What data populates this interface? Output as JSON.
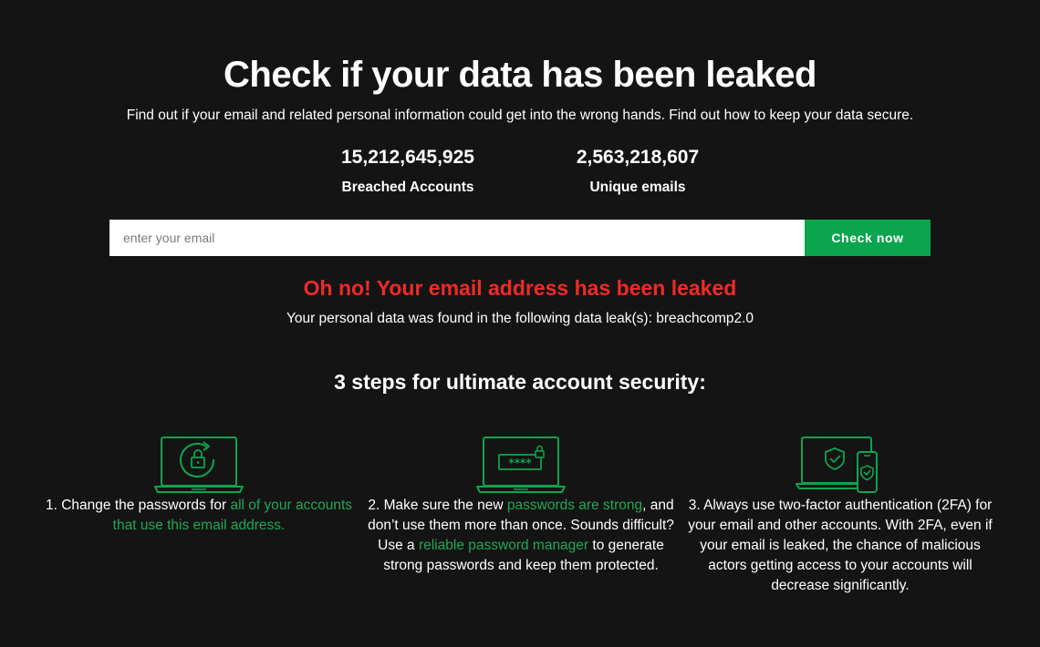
{
  "header": {
    "title": "Check if your data has been leaked",
    "subtitle": "Find out if your email and related personal information could get into the wrong hands. Find out how to keep your data secure."
  },
  "stats": [
    {
      "value": "15,212,645,925",
      "label": "Breached Accounts"
    },
    {
      "value": "2,563,218,607",
      "label": "Unique emails"
    }
  ],
  "search": {
    "placeholder": "enter your email",
    "value": "",
    "button_label": "Check now"
  },
  "result": {
    "alert": "Oh no! Your email address has been leaked",
    "details": "Your personal data was found in the following data leak(s): breachcomp2.0"
  },
  "steps_section": {
    "title": "3 steps for ultimate account security:",
    "steps": [
      {
        "icon": "laptop-refresh-lock-icon",
        "before": "1. Change the passwords for ",
        "link": "all of your accounts that use this email address.",
        "after": ""
      },
      {
        "icon": "laptop-password-icon",
        "before": "2. Make sure the new ",
        "link": "passwords are strong",
        "middle": ", and don’t use them more than once. Sounds difficult? Use a ",
        "link2": "reliable password manager",
        "after": " to generate strong passwords and keep them protected."
      },
      {
        "icon": "laptop-phone-shield-icon",
        "text": "3. Always use two-factor authentication (2FA) for your email and other accounts. With 2FA, even if your email is leaked, the chance of malicious actors getting access to your accounts will decrease significantly."
      }
    ]
  },
  "colors": {
    "background": "#141414",
    "accent_green": "#0ca54f",
    "alert_red": "#ee2a2a"
  }
}
